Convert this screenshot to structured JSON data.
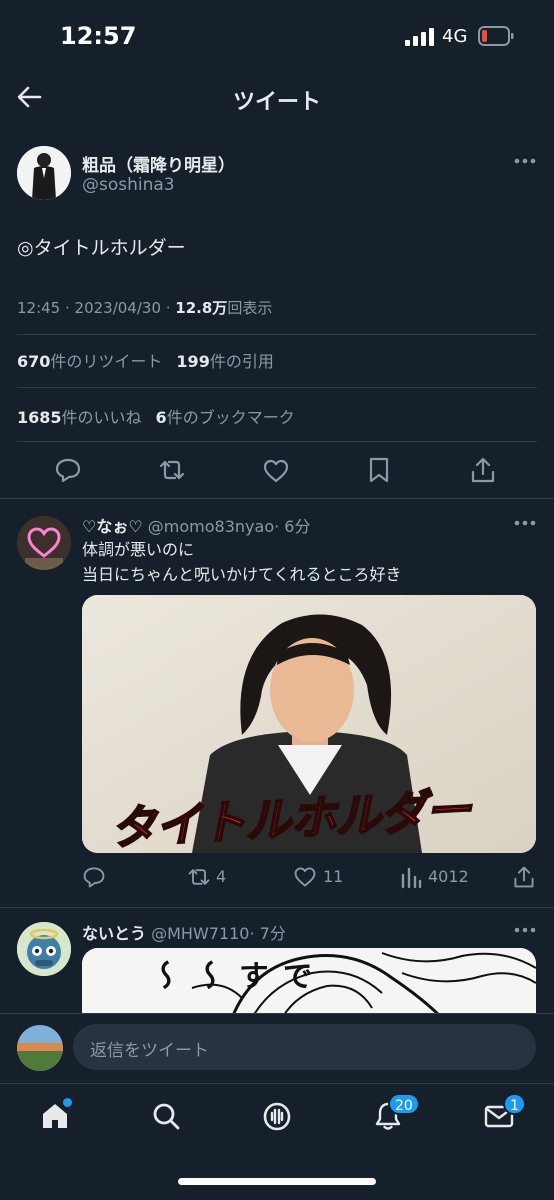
{
  "status": {
    "time": "12:57",
    "network": "4G"
  },
  "header": {
    "title": "ツイート"
  },
  "tweet": {
    "author_name": "粗品（霜降り明星）",
    "author_handle": "@soshina3",
    "text": "◎タイトルホルダー",
    "time": "12:45 · 2023/04/30 · ",
    "views_count": "12.8万",
    "views_label": "回表示",
    "retweets_count": "670",
    "retweets_label": "件のリツイート",
    "quotes_count": "199",
    "quotes_label": "件の引用",
    "likes_count": "1685",
    "likes_label": "件のいいね",
    "bookmarks_count": "6",
    "bookmarks_label": "件のブックマーク"
  },
  "replies": [
    {
      "name": "♡なぉ♡",
      "handle": "@momo83nyao",
      "time": "· 6分",
      "line1": "体調が悪いのに",
      "line2": "当日にちゃんと呪いかけてくれるところ好き",
      "media_caption": "タイトルホルダー",
      "retweets": "4",
      "likes": "11",
      "views": "4012"
    },
    {
      "name": "ないとう",
      "handle": "@MHW7110",
      "time": "· 7分",
      "media_text": "です～～"
    }
  ],
  "composer": {
    "placeholder": "返信をツイート"
  },
  "nav": {
    "notifications_badge": "20",
    "messages_badge": "1"
  },
  "colors": {
    "background": "#15202b",
    "accent": "#1d9bf0",
    "muted": "#8b98a5",
    "caption_red": "#e5231b"
  }
}
